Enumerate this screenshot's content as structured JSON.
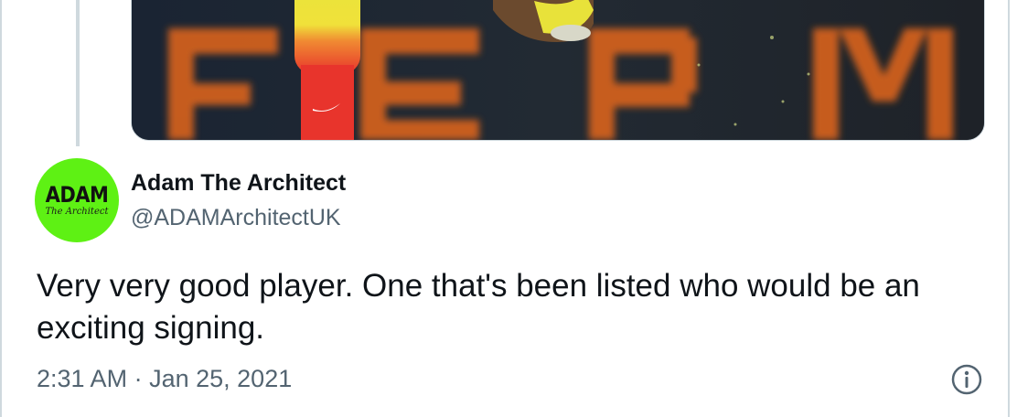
{
  "tweet": {
    "author": {
      "display_name": "Adam The Architect",
      "handle": "@ADAMArchitectUK",
      "avatar": {
        "word": "ADAM",
        "subtitle": "The Architect",
        "background": "#5ef114"
      }
    },
    "text": "Very very good player. One that's been listed who would be an exciting signing.",
    "time": "2:31 AM",
    "separator": "·",
    "date": "Jan 25, 2021",
    "info_icon": "info-circle-icon"
  },
  "colors": {
    "text_primary": "#0f1419",
    "text_secondary": "#536471",
    "border": "#cfd9de"
  }
}
